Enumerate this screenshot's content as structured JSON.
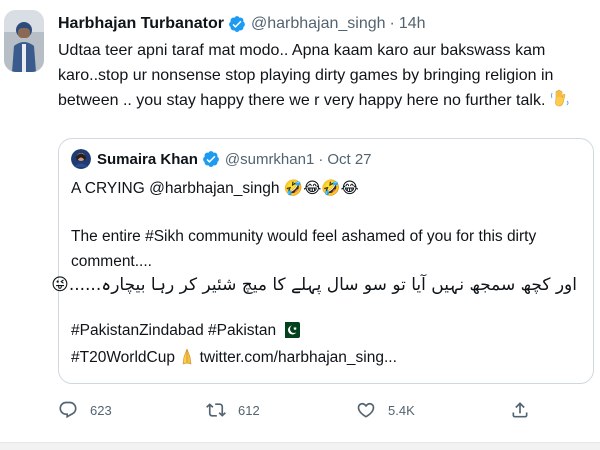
{
  "tweet": {
    "display_name": "Harbhajan Turbanator",
    "handle": "@harbhajan_singh",
    "separator": "·",
    "time": "14h",
    "text_lines": [
      "Udtaa teer apni taraf mat modo.. Apna kaam karo aur bakswass kam",
      "karo..stop ur nonsense stop playing dirty games by bringing religion in",
      "between .. you stay happy there we r very happy here no further talk."
    ],
    "verified_icon": "verified-badge-icon",
    "trailing_emoji": "waving-hand-icon"
  },
  "quote": {
    "display_name": "Sumaira Khan",
    "handle": "@sumrkhan1",
    "separator": "·",
    "time": "Oct 27",
    "line1": "A CRYING @harbhajan_singh",
    "line1_emoji": "🤣😂🤣😂",
    "line2": "The entire #Sikh community would feel ashamed of you for this dirty",
    "line3": "comment....",
    "urdu": "اور کچھ سمجھ نہیں آیا تو سو سال پہلے کا میچ شئیر کر رہا بیچارہ......",
    "urdu_emoji": "😜",
    "hashtags1": "#PakistanZindabad #Pakistan",
    "hashtags1_flag": "pakistan-flag-icon",
    "hashtags2": "#T20WorldCup",
    "hashtags2_emoji": "praying-hands-icon",
    "link": "twitter.com/harbhajan_sing..."
  },
  "actions": {
    "reply_count": "623",
    "retweet_count": "612",
    "like_count": "5.4K"
  },
  "colors": {
    "verified": "#1d9bf0",
    "muted": "#536471",
    "text": "#0f1419",
    "border": "#cfd9de"
  }
}
